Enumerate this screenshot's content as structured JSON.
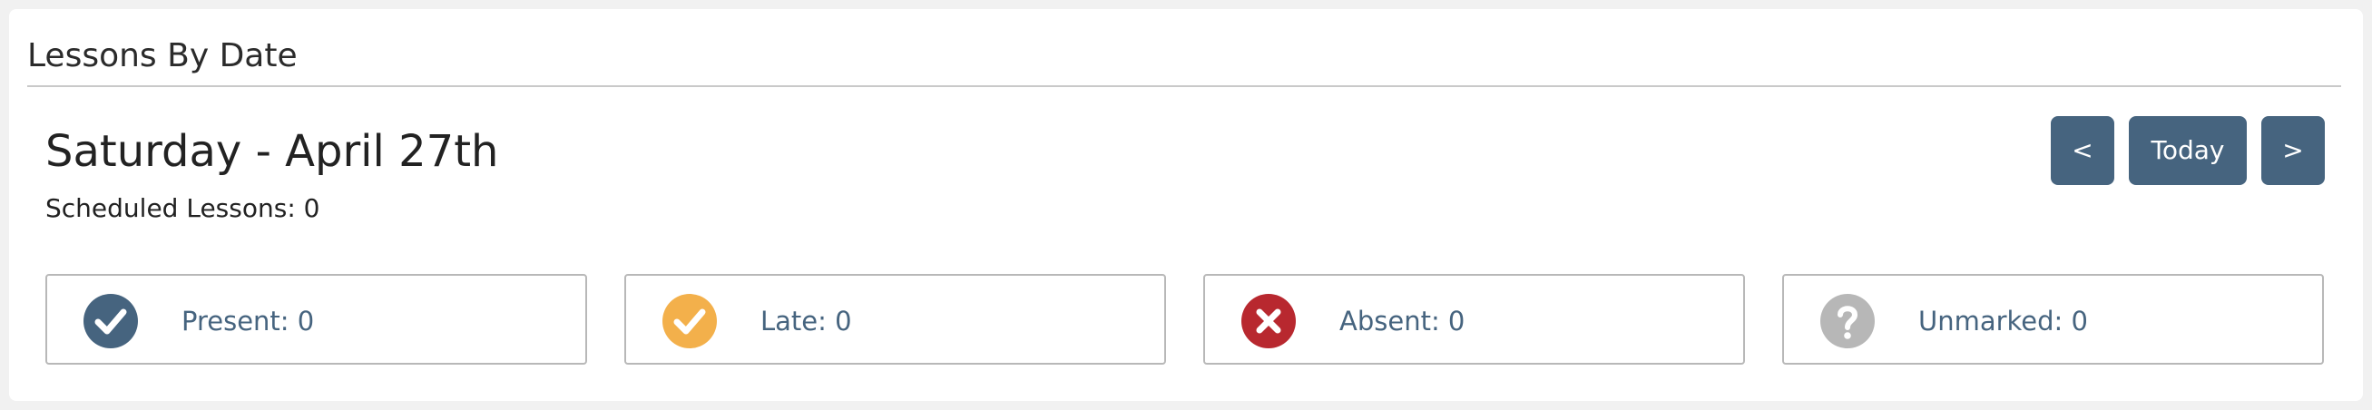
{
  "section": {
    "title": "Lessons By Date"
  },
  "day": {
    "heading": "Saturday - April 27th",
    "scheduled": "Scheduled Lessons: 0"
  },
  "nav": {
    "prev_label": "<",
    "today_label": "Today",
    "next_label": ">"
  },
  "stats": [
    {
      "label": "Present: 0",
      "icon": "check-circle-icon",
      "color": "#46647f"
    },
    {
      "label": "Late: 0",
      "icon": "check-circle-icon",
      "color": "#f3b04b"
    },
    {
      "label": "Absent: 0",
      "icon": "x-circle-icon",
      "color": "#b8282f"
    },
    {
      "label": "Unmarked: 0",
      "icon": "question-circle-icon",
      "color": "#b7b7b7"
    }
  ],
  "colors": {
    "accent": "#46647f",
    "label_text": "#46647f",
    "border": "#b8b8b8"
  }
}
